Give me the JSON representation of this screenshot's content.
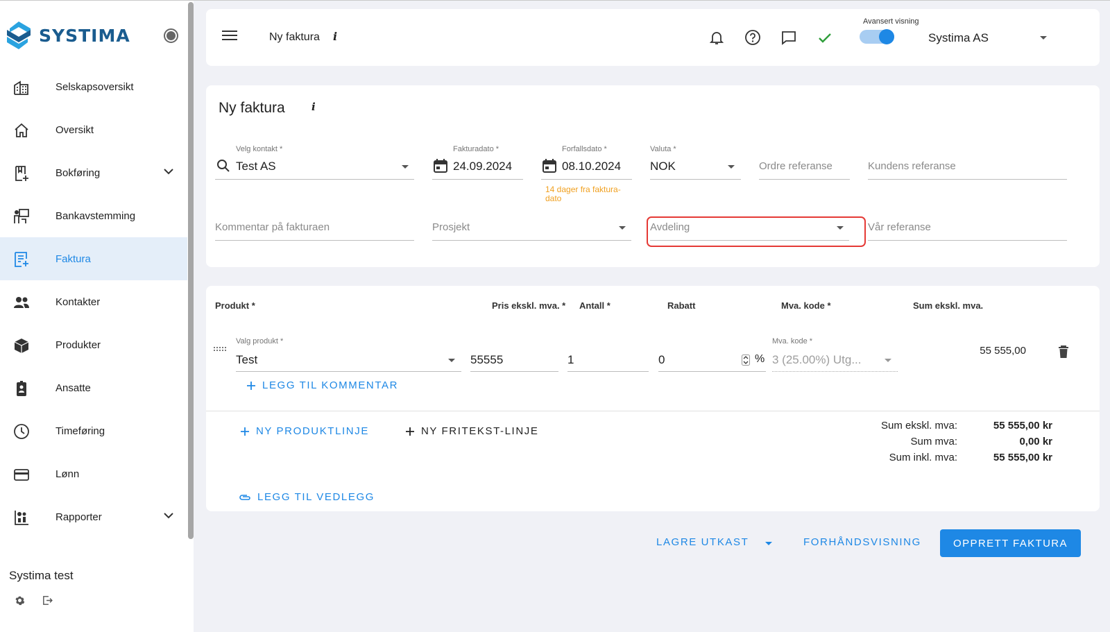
{
  "sidebar": {
    "logo": "SYSTIMA",
    "items": [
      {
        "label": "Selskapsoversikt"
      },
      {
        "label": "Oversikt"
      },
      {
        "label": "Bokføring"
      },
      {
        "label": "Bankavstemming"
      },
      {
        "label": "Faktura"
      },
      {
        "label": "Kontakter"
      },
      {
        "label": "Produkter"
      },
      {
        "label": "Ansatte"
      },
      {
        "label": "Timeføring"
      },
      {
        "label": "Lønn"
      },
      {
        "label": "Rapporter"
      }
    ],
    "company": "Systima test"
  },
  "header": {
    "title": "Ny faktura",
    "info": "i",
    "advanced_label": "Avansert visning",
    "advanced_on": true,
    "company": "Systima AS"
  },
  "form": {
    "title": "Ny faktura",
    "info": "i",
    "contact": {
      "label": "Velg kontakt *",
      "value": "Test AS"
    },
    "invoice_date": {
      "label": "Fakturadato *",
      "value": "24.09.2024"
    },
    "due_date": {
      "label": "Forfallsdato *",
      "value": "08.10.2024",
      "hint": "14 dager fra faktura-dato"
    },
    "currency": {
      "label": "Valuta *",
      "value": "NOK"
    },
    "order_ref": {
      "placeholder": "Ordre referanse"
    },
    "customer_ref": {
      "placeholder": "Kundens referanse"
    },
    "comment": {
      "placeholder": "Kommentar på fakturaen"
    },
    "project": {
      "placeholder": "Prosjekt"
    },
    "department": {
      "placeholder": "Avdeling"
    },
    "our_ref": {
      "placeholder": "Vår referanse"
    }
  },
  "products": {
    "headers": {
      "product": "Produkt *",
      "price": "Pris ekskl. mva. *",
      "qty": "Antall *",
      "discount": "Rabatt",
      "vat": "Mva. kode *",
      "sum": "Sum ekskl. mva."
    },
    "row": {
      "product_label": "Valg produkt *",
      "product": "Test",
      "price": "55555",
      "qty": "1",
      "discount": "0",
      "percent": "%",
      "vat_label": "Mva. kode *",
      "vat": "3 (25.00%) Utg...",
      "sum": "55 555,00"
    },
    "add_comment": "LEGG TIL KOMMENTAR",
    "new_product_line": "NY PRODUKTLINJE",
    "new_text_line": "NY FRITEKST-LINJE",
    "add_attachment": "LEGG TIL VEDLEGG",
    "totals": [
      {
        "label": "Sum ekskl. mva:",
        "value": "55 555,00 kr"
      },
      {
        "label": "Sum mva:",
        "value": "0,00 kr"
      },
      {
        "label": "Sum inkl. mva:",
        "value": "55 555,00 kr"
      }
    ]
  },
  "actions": {
    "save_draft": "LAGRE UTKAST",
    "preview": "FORHÅNDSVISNING",
    "create": "OPPRETT FAKTURA"
  },
  "colors": {
    "accent": "#1e88e5",
    "brand": "#1a5c8f",
    "hint": "#f0a020",
    "highlight": "#e53935",
    "success": "#2e9e3a"
  }
}
